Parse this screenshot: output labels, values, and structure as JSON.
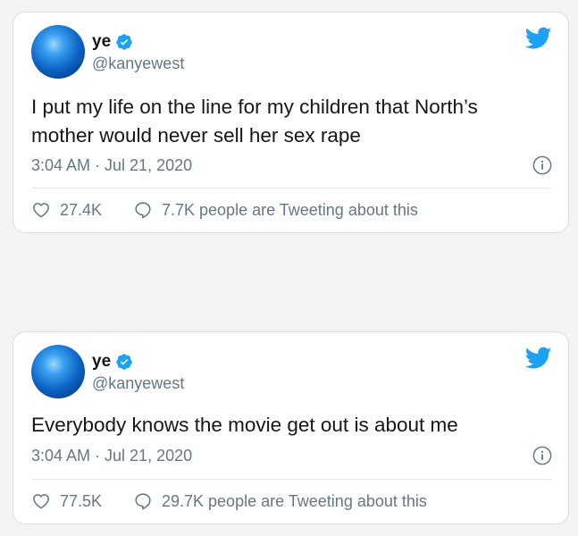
{
  "tweets": [
    {
      "author": {
        "name": "ye",
        "handle": "@kanyewest"
      },
      "text": "I put my life on the line for my children that North’s mother would never sell her sex rape",
      "timestamp": "3:04 AM · Jul 21, 2020",
      "likes": "27.4K",
      "tweeting": "7.7K people are Tweeting about this"
    },
    {
      "author": {
        "name": "ye",
        "handle": "@kanyewest"
      },
      "text": "Everybody knows the movie get out is about me",
      "timestamp": "3:04 AM · Jul 21, 2020",
      "likes": "77.5K",
      "tweeting": "29.7K people are Tweeting about this"
    }
  ],
  "icons": [
    "twitter-bird-icon",
    "verified-badge-icon",
    "info-icon",
    "heart-icon",
    "speech-bubble-icon"
  ],
  "colors": {
    "brand": "#1da1f2",
    "text": "#14171a",
    "muted": "#657786",
    "border": "#e1e8ed"
  }
}
